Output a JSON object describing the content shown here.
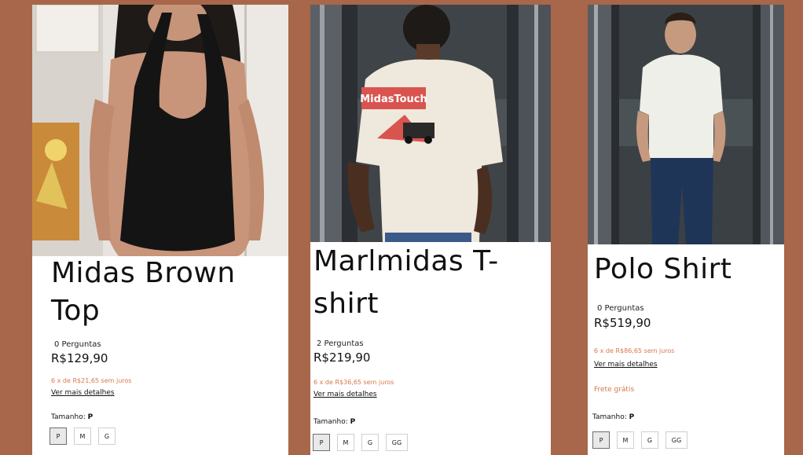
{
  "products": [
    {
      "name_line1": "Midas Brown",
      "name_line2": "Top",
      "questions": "0 Perguntas",
      "price": "R$129,90",
      "installments": "6 x de R$21,65 sem juros",
      "details_link": "Ver mais detalhes",
      "size_label": "Tamanho:",
      "size_selected": "P",
      "sizes": [
        "P",
        "M",
        "G"
      ]
    },
    {
      "name_line1": "Marlmidas T-",
      "name_line2": "shirt",
      "questions": "2 Perguntas",
      "price": "R$219,90",
      "installments": "6 x de R$36,65 sem juros",
      "details_link": "Ver mais detalhes",
      "size_label": "Tamanho:",
      "size_selected": "P",
      "sizes": [
        "P",
        "M",
        "G",
        "GG"
      ],
      "print_text": "MidasTouch"
    },
    {
      "name_line1": "Polo Shirt",
      "questions": "0 Perguntas",
      "price": "R$519,90",
      "installments": "6 x de R$86,65 sem juros",
      "details_link": "Ver mais detalhes",
      "shipping": "Frete grátis",
      "size_label": "Tamanho:",
      "size_selected": "P",
      "sizes": [
        "P",
        "M",
        "G",
        "GG"
      ]
    }
  ],
  "colors": {
    "background": "#a8674a",
    "accent_text": "#d9774c"
  }
}
